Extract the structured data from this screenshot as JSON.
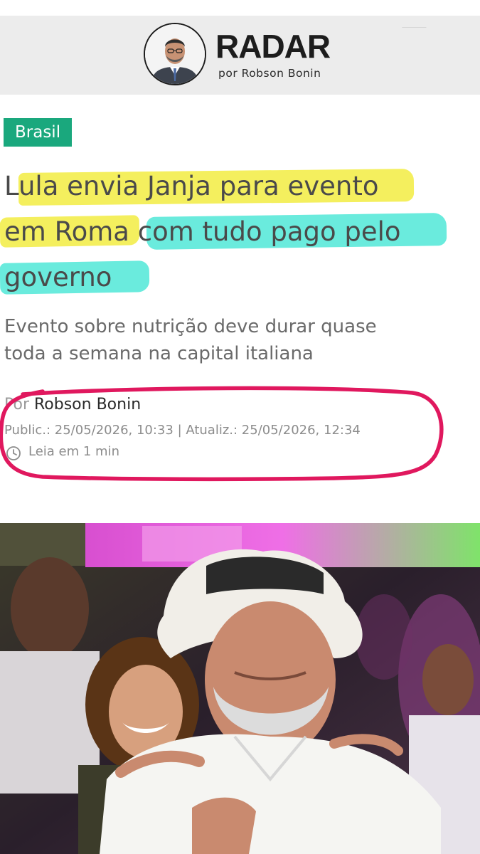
{
  "header": {
    "brand": "RADAR",
    "byline": "por Robson Bonin"
  },
  "article": {
    "section": "Brasil",
    "headline": {
      "line1": "Lula envia Janja para evento",
      "line2": "em Roma com tudo pago pelo",
      "line3": "governo"
    },
    "subtitle": {
      "line1": "Evento sobre nutrição deve durar quase",
      "line2": "toda a semana na capital italiana"
    },
    "author_prefix": "Por",
    "author": "Robson Bonin",
    "dates": "Public.: 25/05/2026, 10:33 | Atualiz.: 25/05/2026, 12:34",
    "read_time": "Leia em 1 min"
  },
  "colors": {
    "section_tag": "#1aa87d",
    "highlight_yellow": "#f3ee55",
    "highlight_cyan": "#62eadb",
    "annotation_circle": "#e0185e"
  },
  "icons": [
    "clock-icon"
  ]
}
